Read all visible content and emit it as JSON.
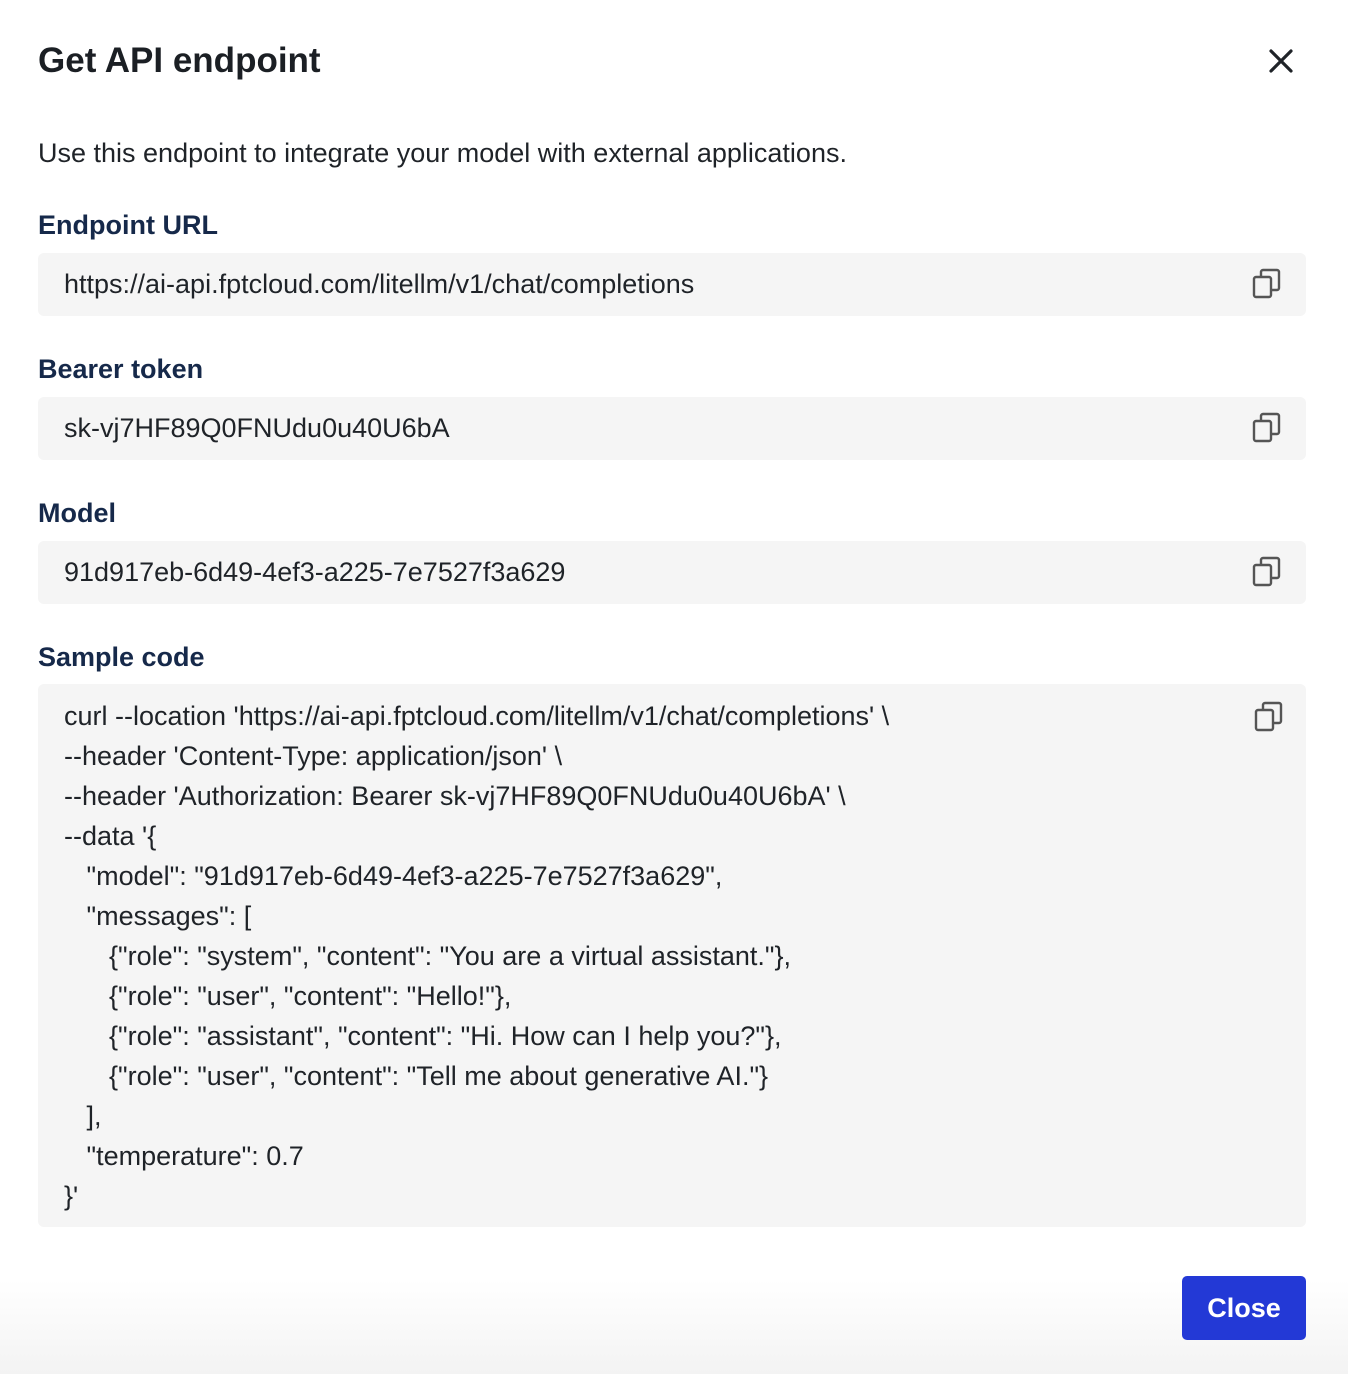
{
  "dialog": {
    "title": "Get API endpoint",
    "description": "Use this endpoint to integrate your model with external applications.",
    "close_button_label": "Close"
  },
  "fields": {
    "endpoint": {
      "label": "Endpoint URL",
      "value": "https://ai-api.fptcloud.com/litellm/v1/chat/completions"
    },
    "token": {
      "label": "Bearer token",
      "value": "sk-vj7HF89Q0FNUdu0u40U6bA"
    },
    "model": {
      "label": "Model",
      "value": "91d917eb-6d49-4ef3-a225-7e7527f3a629"
    }
  },
  "sample_code": {
    "label": "Sample code",
    "lines": [
      "curl --location 'https://ai-api.fptcloud.com/litellm/v1/chat/completions' \\",
      "--header 'Content-Type: application/json' \\",
      "--header 'Authorization: Bearer sk-vj7HF89Q0FNUdu0u40U6bA' \\",
      "--data '{",
      "   \"model\": \"91d917eb-6d49-4ef3-a225-7e7527f3a629\",",
      "   \"messages\": [",
      "      {\"role\": \"system\", \"content\": \"You are a virtual assistant.\"},",
      "      {\"role\": \"user\", \"content\": \"Hello!\"},",
      "      {\"role\": \"assistant\", \"content\": \"Hi. How can I help you?\"},",
      "      {\"role\": \"user\", \"content\": \"Tell me about generative AI.\"}",
      "   ],",
      "   \"temperature\": 0.7",
      "}'"
    ]
  },
  "icons": {
    "close": "close-icon",
    "copy": "copy-icon"
  },
  "colors": {
    "primary_button": "#2339d6",
    "label_text": "#16294a",
    "field_background": "#f5f5f5"
  }
}
